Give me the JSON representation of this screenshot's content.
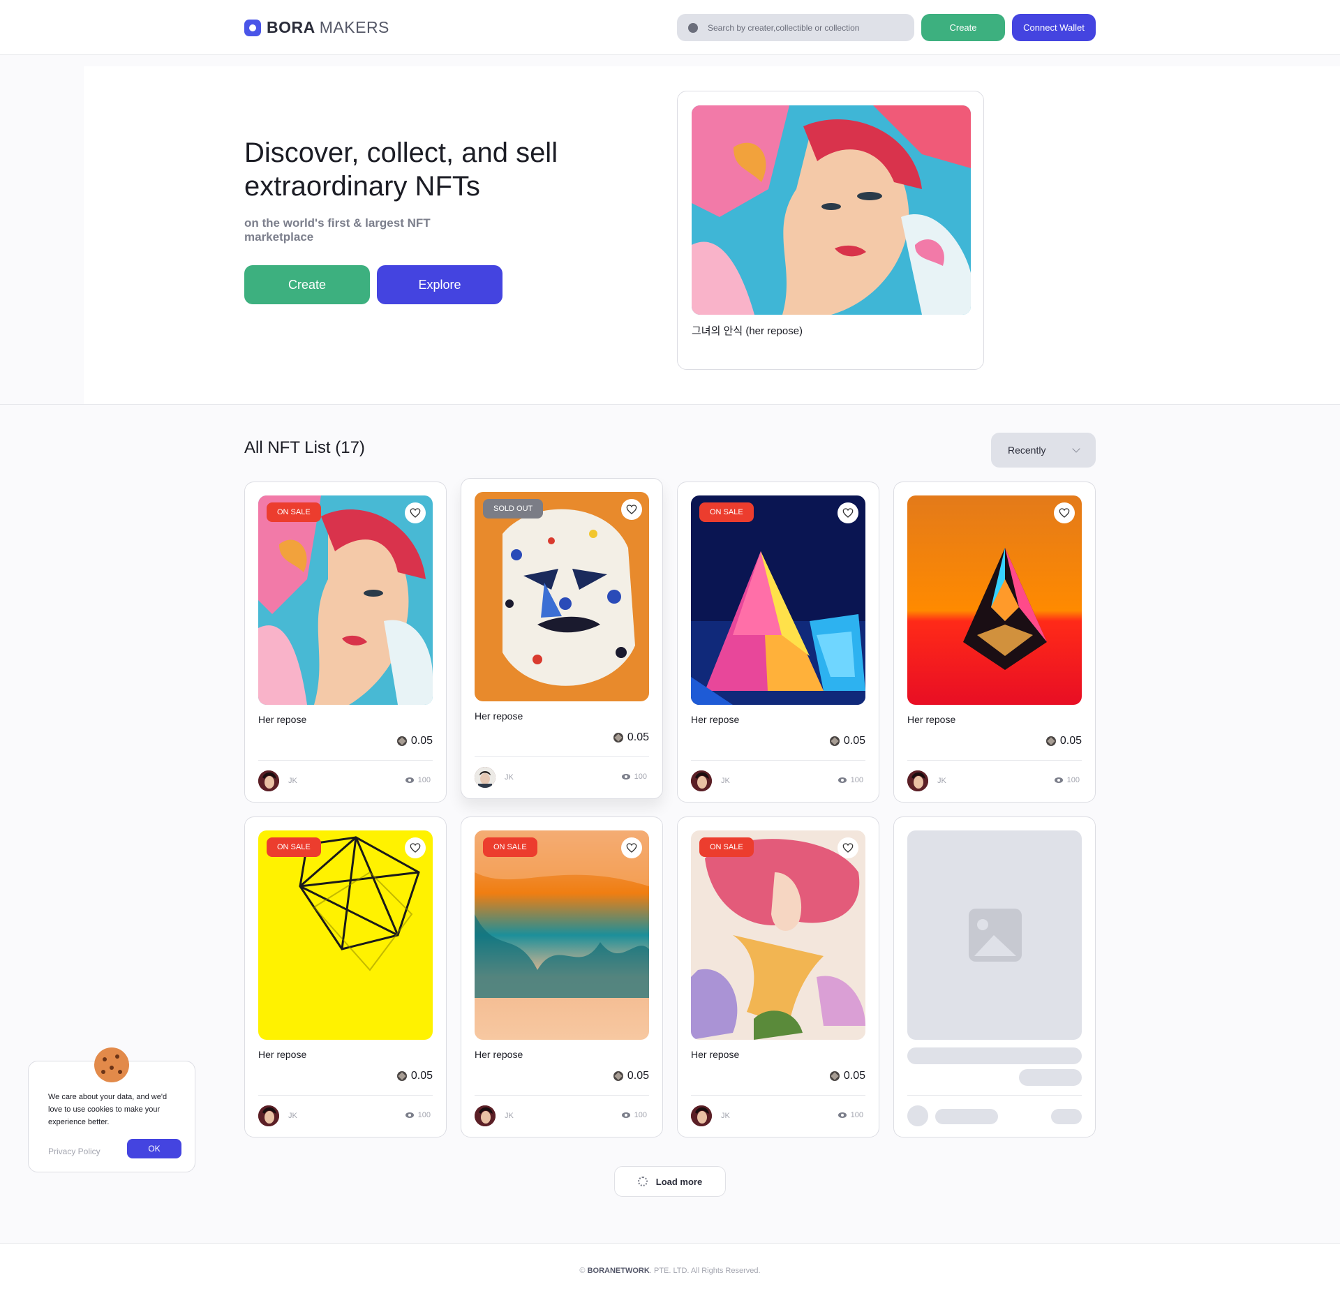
{
  "header": {
    "logo_bold": "BORA",
    "logo_light": "MAKERS",
    "search_placeholder": "Search by creater,collectible or collection",
    "create_label": "Create",
    "wallet_label": "Connect Wallet",
    "accent": "#4444e0",
    "green": "#3db07f"
  },
  "hero": {
    "title": "Discover, collect, and sell extraordinary NFTs",
    "subtitle": "on the world's first & largest NFT marketplace",
    "create_label": "Create",
    "explore_label": "Explore",
    "featured_title": "그녀의 안식 (her repose)"
  },
  "list": {
    "title": "All NFT List (17)",
    "sort_value": "Recently",
    "cards": [
      {
        "badge": "ON SALE",
        "title": "Her repose",
        "price": "0.05",
        "owner": "JK",
        "views": "100"
      },
      {
        "badge": "SOLD OUT",
        "title": "Her repose",
        "price": "0.05",
        "owner": "JK",
        "views": "100"
      },
      {
        "badge": "ON SALE",
        "title": "Her repose",
        "price": "0.05",
        "owner": "JK",
        "views": "100"
      },
      {
        "badge": "",
        "title": "Her repose",
        "price": "0.05",
        "owner": "JK",
        "views": "100"
      },
      {
        "badge": "ON SALE",
        "title": "Her repose",
        "price": "0.05",
        "owner": "JK",
        "views": "100"
      },
      {
        "badge": "ON SALE",
        "title": "Her repose",
        "price": "0.05",
        "owner": "JK",
        "views": "100"
      },
      {
        "badge": "ON SALE",
        "title": "Her repose",
        "price": "0.05",
        "owner": "JK",
        "views": "100"
      }
    ],
    "load_more": "Load more"
  },
  "cookie": {
    "text": "We care about your data, and we'd love to use cookies to make your experience better.",
    "privacy": "Privacy Policy",
    "ok": "OK"
  },
  "footer": {
    "brand": "BORANETWORK",
    "rest": "PTE. LTD. All Rights Reserved."
  }
}
